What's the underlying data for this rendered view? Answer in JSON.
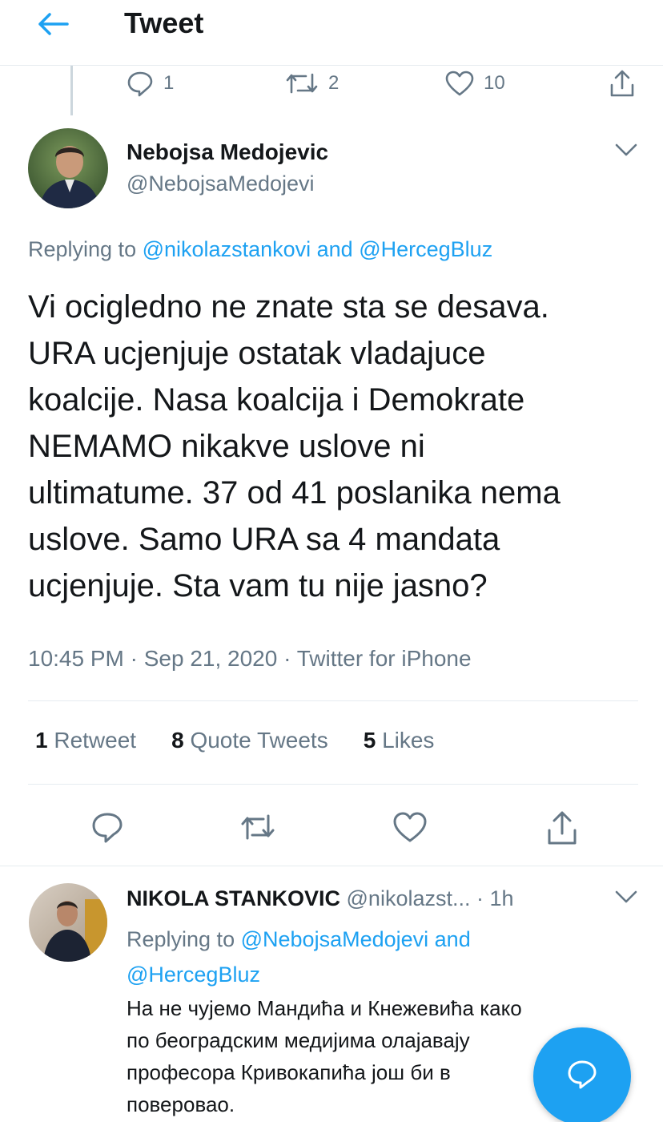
{
  "header": {
    "title": "Tweet",
    "back_icon": "arrow-left-icon"
  },
  "colors": {
    "accent": "#1da1f2",
    "secondary_text": "#657786",
    "primary_text": "#14171a",
    "divider": "#e6ecf0"
  },
  "previous_tweet_actions": {
    "reply_count": "1",
    "retweet_count": "2",
    "like_count": "10"
  },
  "tweet": {
    "author_name": "Nebojsa Medojevic",
    "author_handle": "@NebojsaMedojevi",
    "replying_prefix": "Replying to",
    "replying_to_1": "@nikolazstankovi",
    "replying_and": "and",
    "replying_to_2": "@HercegBluz",
    "text": "Vi ocigledno ne znate sta se desava.\nURA ucjenjuje ostatak vladajuce\nkoalcije. Nasa koalcija i Demokrate\nNEMAMO nikakve uslove ni\nultimatume. 37 od 41 poslanika nema\nuslove. Samo URA sa 4 mandata\nucjenjuje. Sta vam tu nije jasno?",
    "meta": "10:45 PM · Sep 21, 2020 · Twitter for iPhone",
    "stats": {
      "retweets_count": "1",
      "retweets_label": "Retweet",
      "quotes_count": "8",
      "quotes_label": "Quote Tweets",
      "likes_count": "5",
      "likes_label": "Likes"
    }
  },
  "reply": {
    "author_name": "NIKOLA STANKOVIC",
    "author_handle": "@nikolazst...",
    "time": "· 1h",
    "replying_prefix": "Replying to",
    "replying_to_1": "@NebojsaMedojevi",
    "replying_and": "and",
    "replying_to_2": "@HercegBluz",
    "text": "На не чујемо Мандића и Кнежевића како\nпо београдским медијима олајавају\nпрофесора  Кривокапића још би в\nповеровао."
  }
}
